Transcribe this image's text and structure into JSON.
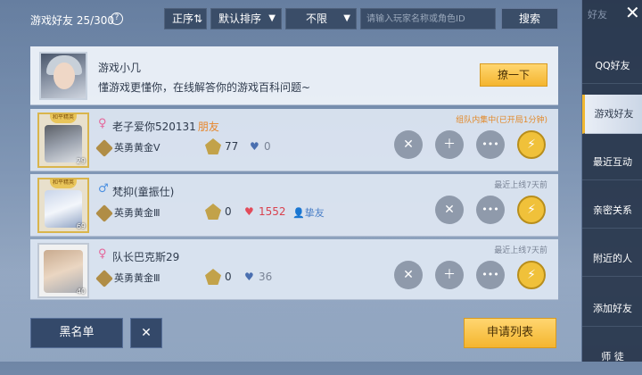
{
  "topbar": {
    "friend_count": "游戏好友 25/300",
    "help_icon": "?",
    "order_label": "正序⇅",
    "sort_label": "默认排序",
    "filter_label": "不限",
    "search_placeholder": "请输入玩家名称或角色ID",
    "search_button": "搜索",
    "dropdown_arrow": "▼"
  },
  "ai_card": {
    "name": "游戏小几",
    "description": "懂游戏更懂你，在线解答你的游戏百科问题~",
    "button": "撩一下"
  },
  "friends": [
    {
      "name": "老子爱你520131",
      "tag": "朋友",
      "gender": "♀",
      "rank": "英勇黄金Ⅴ",
      "badge_count": "77",
      "heart_value": "0",
      "heart_color": "#4a6fb0",
      "status": "组队内集中(已开局1分钟)",
      "level": "29",
      "crest": "和平精英",
      "relation": ""
    },
    {
      "name": "梵抑(童振仕)",
      "tag": "",
      "gender": "♂",
      "rank": "英勇黄金Ⅲ",
      "badge_count": "0",
      "heart_value": "1552",
      "heart_color": "#e24b5a",
      "status": "最近上线7天前",
      "level": "69",
      "crest": "和平精英",
      "relation": "挚友"
    },
    {
      "name": "队长巴克斯29",
      "tag": "",
      "gender": "♀",
      "rank": "英勇黄金Ⅲ",
      "badge_count": "0",
      "heart_value": "36",
      "heart_color": "#4a6fb0",
      "status": "最近上线7天前",
      "level": "40",
      "crest": "",
      "relation": ""
    }
  ],
  "icons": {
    "remove": "✕",
    "add_friend": "＋",
    "chat": "•••",
    "gift": "⚡",
    "heart": "♥",
    "relation": "👤"
  },
  "bottom": {
    "blacklist": "黑名单",
    "apply_list": "申请列表"
  },
  "sidebar": {
    "header": "好友",
    "close": "✕",
    "items": [
      "QQ好友",
      "游戏好友",
      "最近互动",
      "亲密关系",
      "附近的人",
      "添加好友",
      "师 徒"
    ]
  },
  "colors": {
    "accent": "#f4b52f",
    "friend_tag": "#e7862b",
    "female": "#e5669a",
    "male": "#4b8fe0"
  }
}
